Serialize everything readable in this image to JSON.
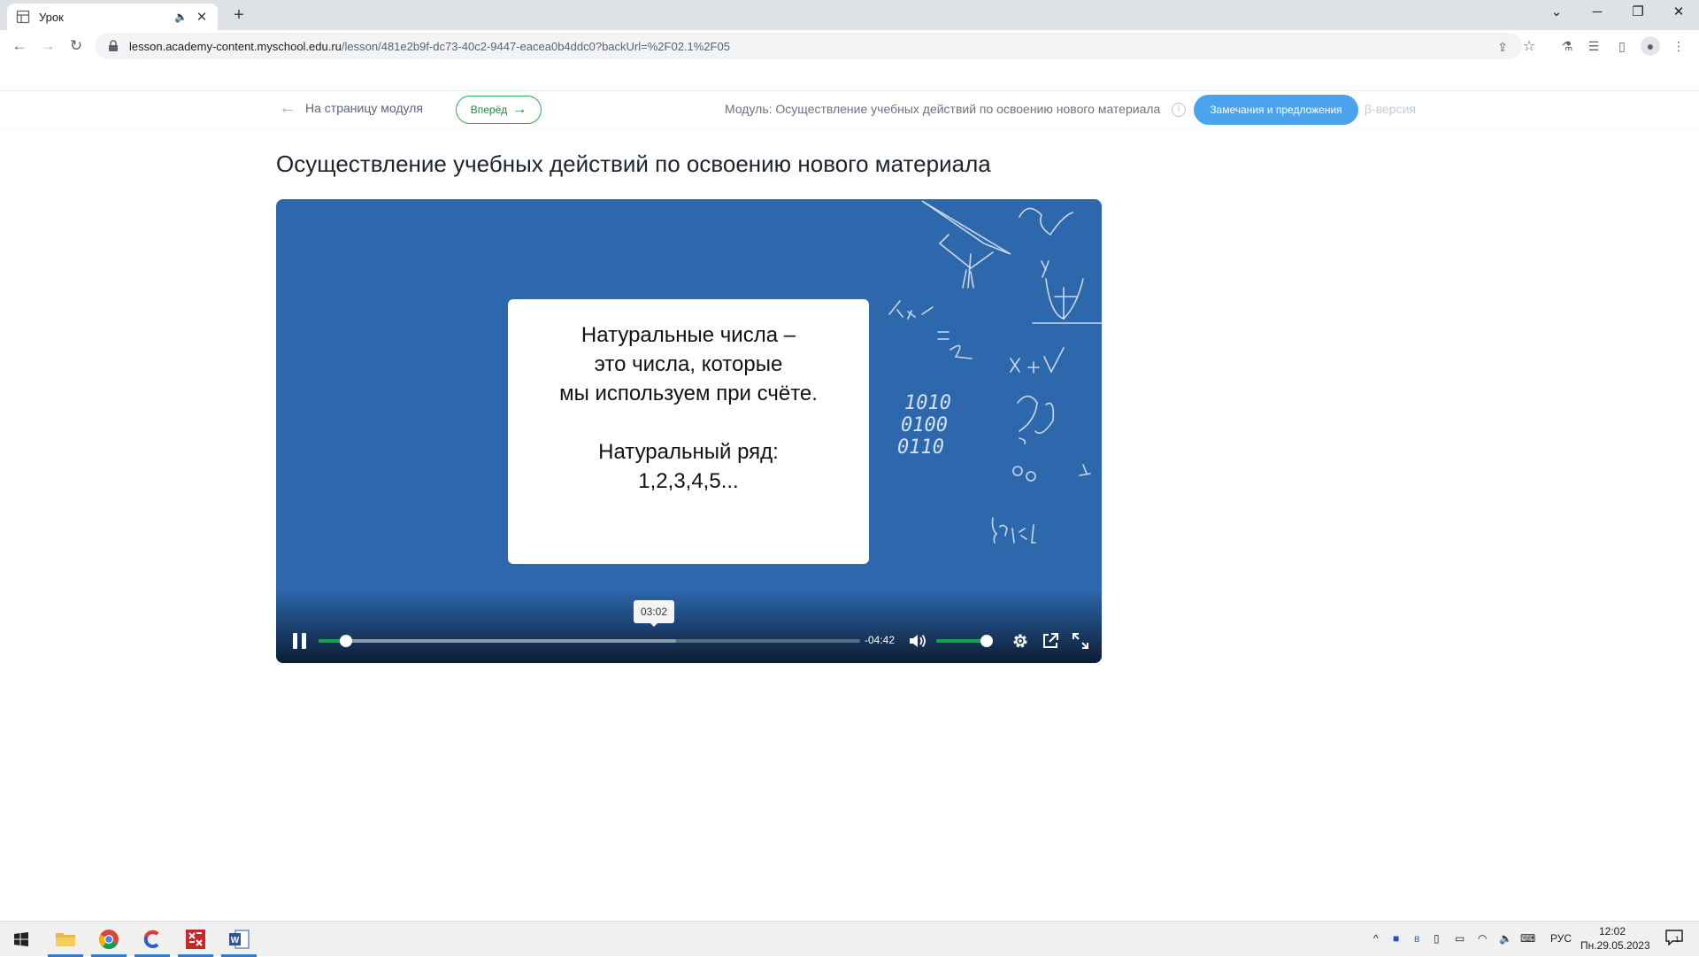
{
  "browser": {
    "tab_title": "Урок",
    "url_host": "lesson.academy-content.myschool.edu.ru",
    "url_path": "/lesson/481e2b9f-dc73-40c2-9447-eacea0b4ddc0?backUrl=%2F02.1%2F05"
  },
  "header": {
    "back_label": "На страницу модуля",
    "forward_label": "Вперёд",
    "module_label": "Модуль: Осуществление учебных действий по освоению нового материала",
    "feedback_label": "Замечания и предложения",
    "beta_label": "β-версия"
  },
  "page": {
    "title": "Осуществление учебных действий по освоению нового материала"
  },
  "slide": {
    "line1": "Натуральные числа –",
    "line2": "это числа, которые",
    "line3": "мы используем при счёте.",
    "line4": "Натуральный ряд:",
    "line5": "1,2,3,4,5..."
  },
  "player": {
    "hover_time": "03:02",
    "remaining_time": "-04:42",
    "progress_fraction": 0.04,
    "buffered_fraction": 0.66,
    "volume_fraction": 0.8
  },
  "taskbar": {
    "lang": "РУС",
    "time": "12:02",
    "date": "Пн.29.05.2023",
    "notifications": "1"
  },
  "colors": {
    "accent_green": "#16a34a",
    "player_blue": "#2d68ad",
    "feedback_blue": "#4aa3ec"
  }
}
